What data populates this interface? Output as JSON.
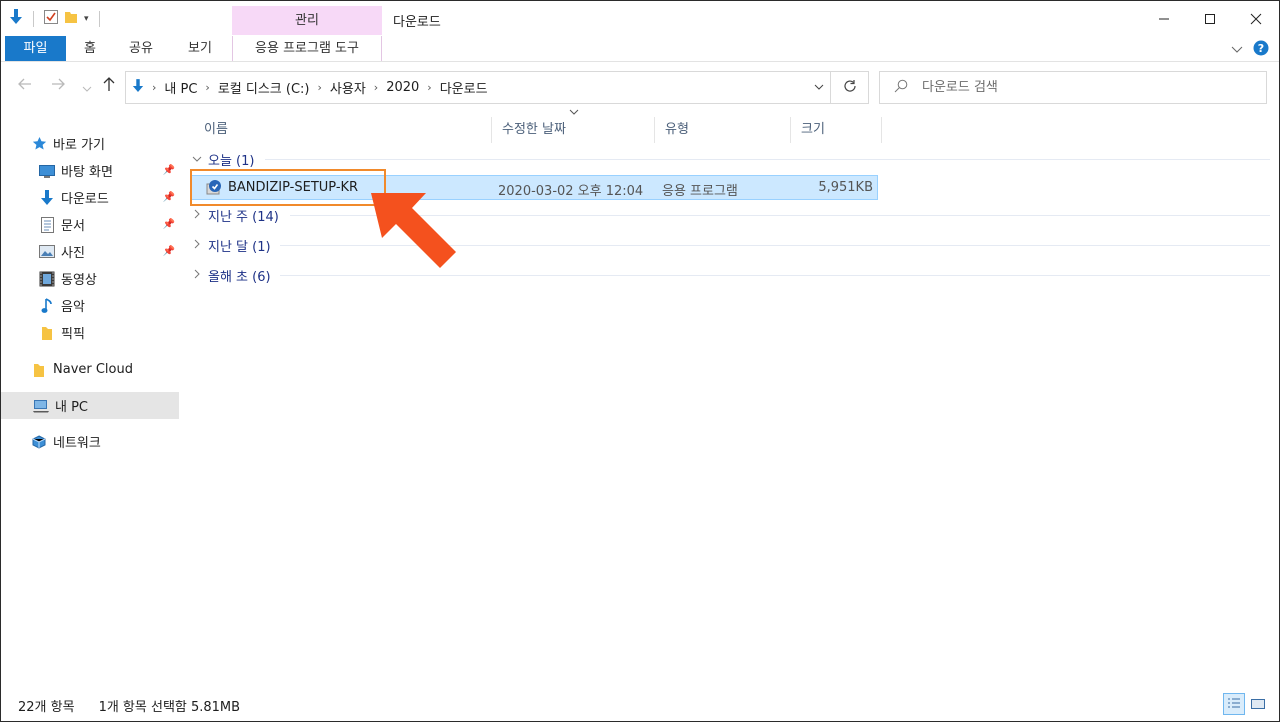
{
  "window": {
    "title": "다운로드",
    "context_tab_header": "관리"
  },
  "ribbon": {
    "tabs": [
      "파일",
      "홈",
      "공유",
      "보기"
    ],
    "context_tab": "응용 프로그램 도구"
  },
  "nav": {
    "breadcrumb": [
      "내 PC",
      "로컬 디스크 (C:)",
      "사용자",
      "2020",
      "다운로드"
    ],
    "search_placeholder": "다운로드 검색"
  },
  "sidebar": {
    "quick_access": "바로 가기",
    "items": [
      {
        "label": "바탕 화면",
        "icon": "desktop-icon",
        "pinned": true
      },
      {
        "label": "다운로드",
        "icon": "download-arrow-icon",
        "pinned": true
      },
      {
        "label": "문서",
        "icon": "document-icon",
        "pinned": true
      },
      {
        "label": "사진",
        "icon": "picture-icon",
        "pinned": true
      },
      {
        "label": "동영상",
        "icon": "video-icon",
        "pinned": false
      },
      {
        "label": "음악",
        "icon": "music-note-icon",
        "pinned": false
      },
      {
        "label": "픽픽",
        "icon": "folder-icon",
        "pinned": false
      }
    ],
    "naver_cloud": "Naver Cloud",
    "this_pc": "내 PC",
    "network": "네트워크"
  },
  "columns": {
    "name": "이름",
    "date": "수정한 날짜",
    "type": "유형",
    "size": "크기"
  },
  "groups": [
    {
      "label": "오늘 (1)",
      "expanded": true
    },
    {
      "label": "지난 주 (14)",
      "expanded": false
    },
    {
      "label": "지난 달 (1)",
      "expanded": false
    },
    {
      "label": "올해 초 (6)",
      "expanded": false
    }
  ],
  "files": [
    {
      "name": "BANDIZIP-SETUP-KR",
      "date": "2020-03-02 오후 12:04",
      "type": "응용 프로그램",
      "size": "5,951KB",
      "selected": true
    }
  ],
  "status": {
    "item_count": "22개 항목",
    "selection": "1개 항목 선택함 5.81MB"
  },
  "colors": {
    "accent": "#1979ca",
    "context_tab": "#f7d9f7",
    "selection": "#cce8ff",
    "group_text": "#1e3287",
    "annotation": "#f4511e"
  }
}
